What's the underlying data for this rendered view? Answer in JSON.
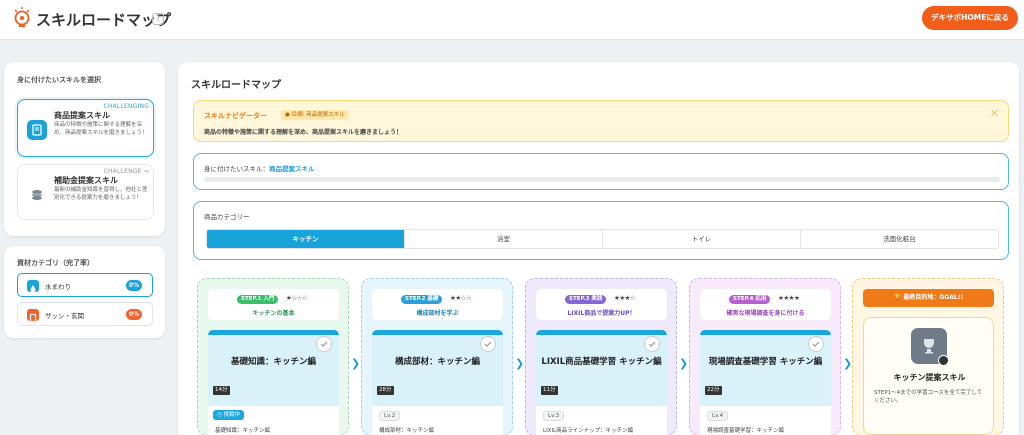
{
  "header": {
    "title": "スキルロードマップ",
    "help": "?",
    "home_button": "デキサポHOMEに戻る"
  },
  "left": {
    "skills_title": "身に付けたいスキルを選択",
    "skills": [
      {
        "name": "商品提案スキル",
        "tag": "CHALLENGING",
        "desc": "商品の特徴や施策に関する理解を深め、商品提案スキルを磨きましょう！",
        "icon": "book-icon",
        "color": "#1aa3d8"
      },
      {
        "name": "補助金提案スキル",
        "tag": "CHALLENGE ⇒",
        "desc": "最新の補助金知識を習得し、他社と差別化できる提案力を磨きましょう！",
        "icon": "coins-icon",
        "color": "#7b8794"
      }
    ],
    "materials_title": "資材カテゴリ（完了率）",
    "materials": [
      {
        "label": "水まわり",
        "pct": "0%",
        "color": "#1aa3d8",
        "icon": "water-drop-icon"
      },
      {
        "label": "サッシ・玄関",
        "pct": "0%",
        "color": "#f2622e",
        "icon": "door-icon"
      }
    ]
  },
  "main": {
    "title": "スキルロードマップ",
    "navigator": {
      "title": "スキルナビゲーター",
      "goal": "目標: 商品提案スキル",
      "desc": "商品の特徴や施策に関する理解を深め、商品提案スキルを磨きましょう！",
      "close": "✕"
    },
    "target": {
      "label": "身に付けたいスキル：",
      "value": "商品提案スキル"
    },
    "category": {
      "label": "商品カテゴリー",
      "tabs": [
        "キッチン",
        "浴室",
        "トイレ",
        "洗面化粧台"
      ],
      "selected": "キッチン"
    },
    "steps": [
      {
        "badge": "STEP.1 入門",
        "stars": "★☆☆☆",
        "subtitle": "キッチンの基本",
        "course": "基礎知識：キッチン編",
        "minutes": "14分",
        "status": "挑戦中",
        "desc": "基礎知識：キッチン編",
        "color": "#3cbf6a"
      },
      {
        "badge": "STEP.2 基礎",
        "stars": "★★☆☆",
        "subtitle": "構成部材を学ぶ",
        "course": "構成部材：キッチン編",
        "minutes": "28分",
        "level": "Lv.2",
        "desc": "構成部材：キッチン編",
        "color": "#2e9fd8"
      },
      {
        "badge": "STEP.3 実践",
        "stars": "★★★☆",
        "subtitle": "LIXIL商品で提案力UP！",
        "course": "LIXIL商品基礎学習 キッチン編",
        "minutes": "11分",
        "level": "Lv.3",
        "desc": "LIXIL商品ラインナップ：キッチン編",
        "color": "#8564d8"
      },
      {
        "badge": "STEP.4 応用",
        "stars": "★★★★",
        "subtitle": "確実な現場調査を身に付ける",
        "course": "現場調査基礎学習 キッチン編",
        "minutes": "22分",
        "level": "Lv.4",
        "desc": "現場調査基礎学習：キッチン編",
        "color": "#b75fd1"
      }
    ],
    "goal": {
      "badge": "最終目的地：GOAL!!",
      "title": "キッチン提案スキル",
      "desc": "STEP1〜4までの学習コースを全て完了してください。"
    }
  }
}
